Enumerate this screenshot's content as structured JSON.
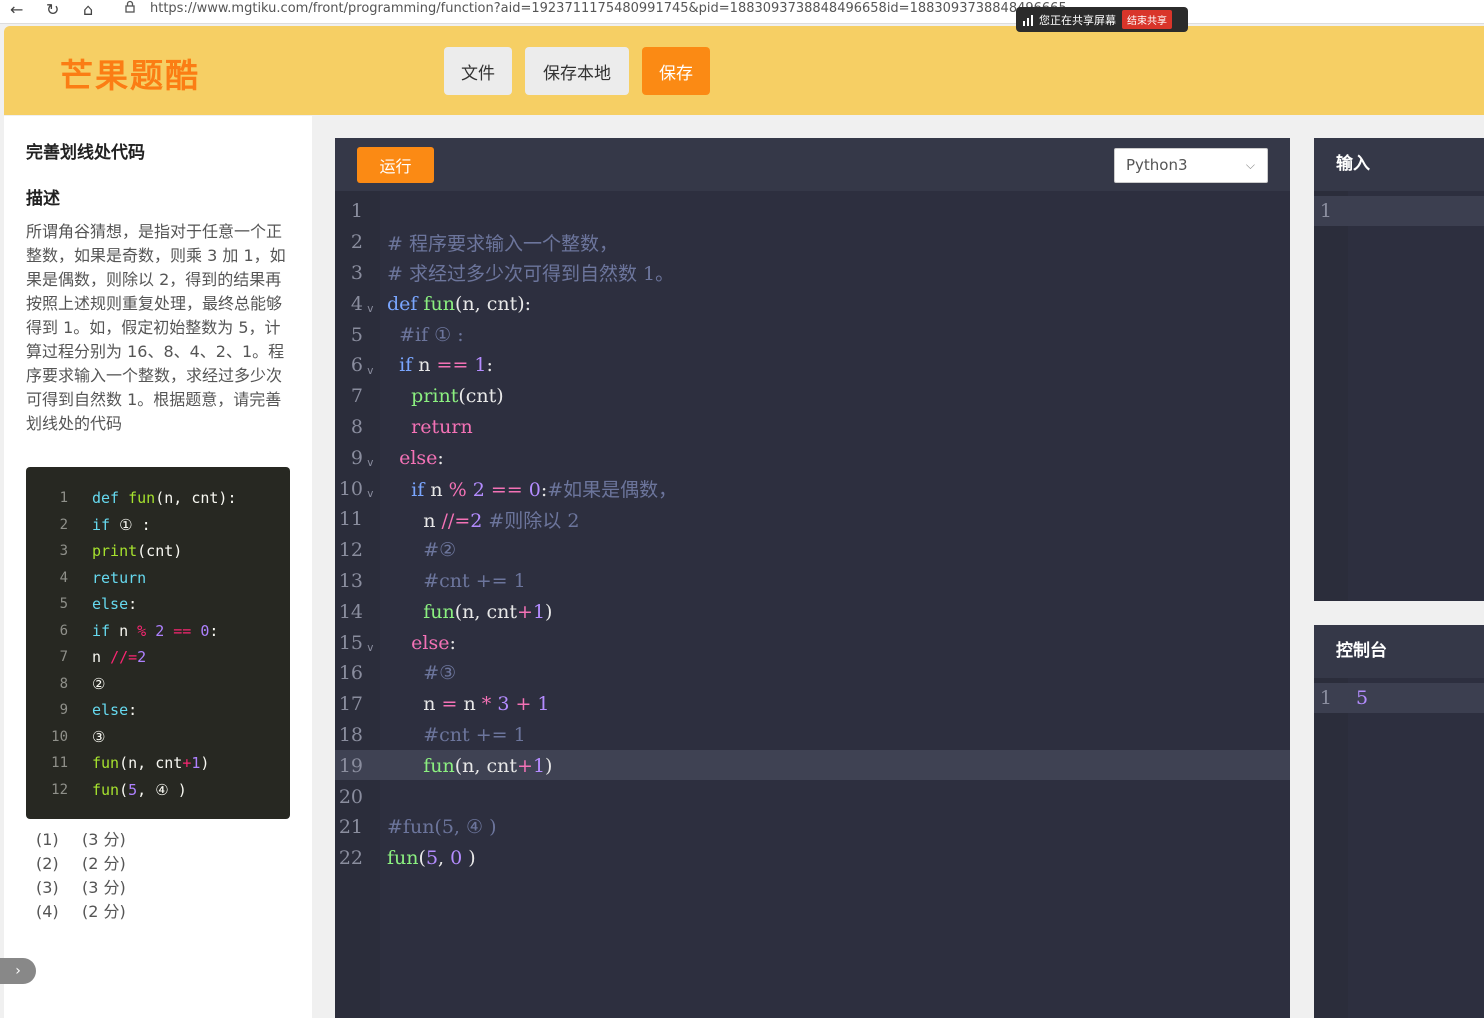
{
  "browser": {
    "url": "https://www.mgtiku.com/front/programming/function?aid=1923711175480991745&pid=1883093738848496658id=1883093738848496665",
    "share_text": "您正在共享屏幕",
    "stop_share": "结束共享"
  },
  "header": {
    "logo": "芒果题酷",
    "file_label": "文件",
    "save_local_label": "保存本地",
    "save_label": "保存"
  },
  "problem": {
    "title": "完善划线处代码",
    "desc_heading": "描述",
    "description": "所谓角谷猜想，是指对于任意一个正整数，如果是奇数，则乘 3 加 1，如果是偶数，则除以 2，得到的结果再按照上述规则重复处理，最终总能够得到 1。如，假定初始整数为 5，计算过程分别为 16、8、4、2、1。程序要求输入一个整数，求经过多少次可得到自然数 1。根据题意，请完善划线处的代码",
    "snippet": [
      {
        "n": "1",
        "code": "def fun(n, cnt):"
      },
      {
        "n": "2",
        "code": "if ① :"
      },
      {
        "n": "3",
        "code": "print(cnt)"
      },
      {
        "n": "4",
        "code": "return"
      },
      {
        "n": "5",
        "code": "else:"
      },
      {
        "n": "6",
        "code": "if n % 2 == 0:"
      },
      {
        "n": "7",
        "code": "n //=2"
      },
      {
        "n": "8",
        "code": "②"
      },
      {
        "n": "9",
        "code": "else:"
      },
      {
        "n": "10",
        "code": "③"
      },
      {
        "n": "11",
        "code": "fun(n, cnt+1)"
      },
      {
        "n": "12",
        "code": "fun(5, ④ )"
      }
    ],
    "scores": [
      {
        "idx": "(1)",
        "pts": "(3 分)"
      },
      {
        "idx": "(2)",
        "pts": "(2 分)"
      },
      {
        "idx": "(3)",
        "pts": "(3 分)"
      },
      {
        "idx": "(4)",
        "pts": "(2 分)"
      }
    ]
  },
  "editor": {
    "run_label": "运行",
    "language": "Python3",
    "current_line": 19,
    "lines": [
      {
        "n": "1",
        "code": ""
      },
      {
        "n": "2",
        "code": "# 程序要求输入一个整数，"
      },
      {
        "n": "3",
        "code": "# 求经过多少次可得到自然数 1。"
      },
      {
        "n": "4",
        "code": "def fun(n, cnt):",
        "fold": true
      },
      {
        "n": "5",
        "code": "  #if ① :"
      },
      {
        "n": "6",
        "code": "  if n == 1:",
        "fold": true
      },
      {
        "n": "7",
        "code": "    print(cnt)"
      },
      {
        "n": "8",
        "code": "    return"
      },
      {
        "n": "9",
        "code": "  else:",
        "fold": true
      },
      {
        "n": "10",
        "code": "    if n % 2 == 0:#如果是偶数，",
        "fold": true
      },
      {
        "n": "11",
        "code": "      n //=2 #则除以 2"
      },
      {
        "n": "12",
        "code": "      #②"
      },
      {
        "n": "13",
        "code": "      #cnt += 1"
      },
      {
        "n": "14",
        "code": "      fun(n, cnt+1)"
      },
      {
        "n": "15",
        "code": "    else:",
        "fold": true
      },
      {
        "n": "16",
        "code": "      #③"
      },
      {
        "n": "17",
        "code": "      n = n * 3 + 1"
      },
      {
        "n": "18",
        "code": "      #cnt += 1"
      },
      {
        "n": "19",
        "code": "      fun(n, cnt+1)"
      },
      {
        "n": "20",
        "code": ""
      },
      {
        "n": "21",
        "code": "#fun(5, ④ )"
      },
      {
        "n": "22",
        "code": "fun(5, 0 )"
      }
    ]
  },
  "input_pane": {
    "title": "输入",
    "line_no": "1",
    "value": ""
  },
  "console_pane": {
    "title": "控制台",
    "line_no": "1",
    "value": "5"
  },
  "colors": {
    "header_bg": "#f6cf64",
    "accent": "#fb8a14",
    "editor_bg": "#2d2f3f"
  },
  "icons": [
    "back-icon",
    "reload-icon",
    "home-icon",
    "lock-icon",
    "signal-icon",
    "chevron-down-icon",
    "chevron-right-icon"
  ]
}
